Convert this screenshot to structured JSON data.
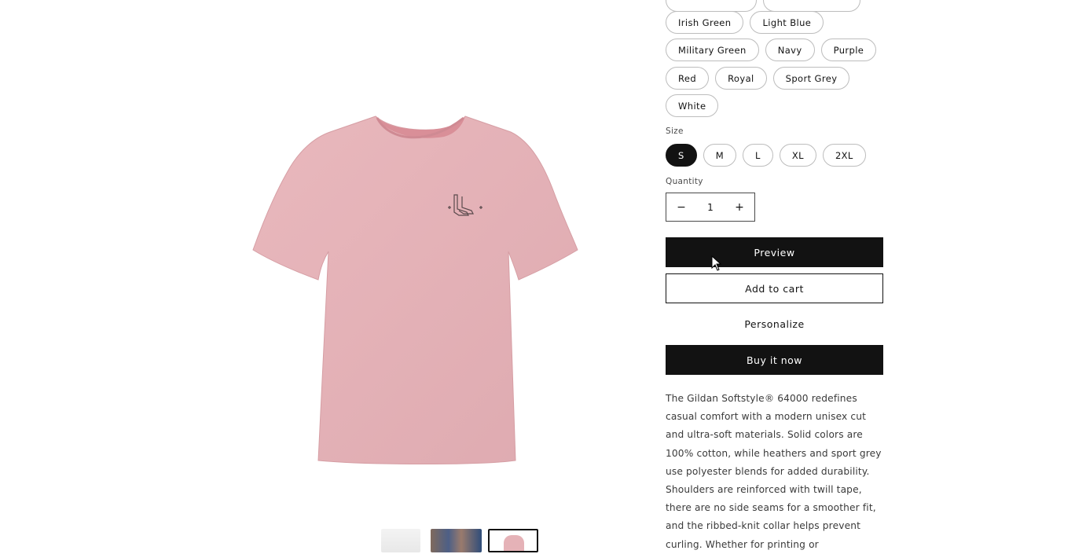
{
  "colors": {
    "accent_dark": "#121212",
    "shirt": "#e5b2b7",
    "border": "#bdbdbd"
  },
  "product": {
    "image_icon": "tshirt-image",
    "chest_graphic_icon": "cowboy-boots-icon"
  },
  "color_options": [
    {
      "label": "Irish Green"
    },
    {
      "label": "Light Blue"
    },
    {
      "label": "Military Green"
    },
    {
      "label": "Navy"
    },
    {
      "label": "Purple"
    },
    {
      "label": "Red"
    },
    {
      "label": "Royal"
    },
    {
      "label": "Sport Grey"
    },
    {
      "label": "White"
    }
  ],
  "size": {
    "label": "Size",
    "options": [
      "S",
      "M",
      "L",
      "XL",
      "2XL"
    ],
    "selected": "S"
  },
  "quantity": {
    "label": "Quantity",
    "value": "1",
    "decrease": "−",
    "increase": "+"
  },
  "buttons": {
    "preview": "Preview",
    "add_to_cart": "Add to cart",
    "personalize": "Personalize",
    "buy_now": "Buy it now"
  },
  "description": "The Gildan Softstyle® 64000 redefines casual comfort with a modern unisex cut and ultra-soft materials. Solid colors are 100% cotton, while heathers and sport grey use polyester blends for added durability. Shoulders are reinforced with twill tape, there are no side seams for a smoother fit, and the ribbed-knit collar helps prevent curling. Whether for printing or"
}
